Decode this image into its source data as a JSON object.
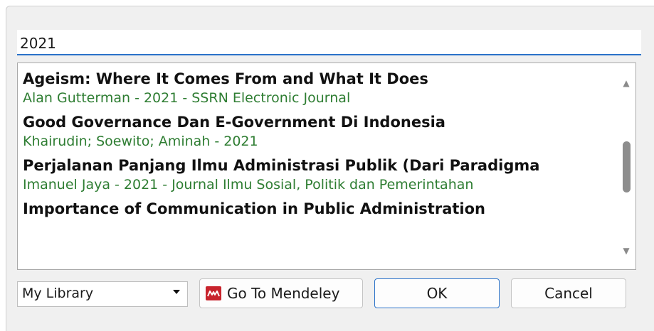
{
  "search": {
    "value": "2021"
  },
  "results": [
    {
      "title": "Ageism: Where It Comes From and What It Does",
      "meta": "Alan Gutterman - 2021 - SSRN Electronic Journal"
    },
    {
      "title": "Good Governance Dan E-Government Di Indonesia",
      "meta": "Khairudin; Soewito; Aminah - 2021"
    },
    {
      "title": "Perjalanan Panjang Ilmu Administrasi Publik (Dari Paradigma",
      "meta": "Imanuel Jaya - 2021 - Journal Ilmu Sosial, Politik dan Pemerintahan"
    },
    {
      "title": "Importance of Communication in Public Administration",
      "meta": ""
    }
  ],
  "footer": {
    "library_select": "My Library",
    "goto_label": "Go To Mendeley",
    "ok_label": "OK",
    "cancel_label": "Cancel"
  },
  "colors": {
    "accent": "#2a72c9",
    "meta_text": "#2e7d32",
    "mendeley_brand": "#c8232c"
  },
  "icons": {
    "scroll_up": "scroll-up-arrow-icon",
    "scroll_down": "scroll-down-arrow-icon",
    "dropdown": "chevron-down-icon",
    "mendeley": "mendeley-logo-icon"
  }
}
